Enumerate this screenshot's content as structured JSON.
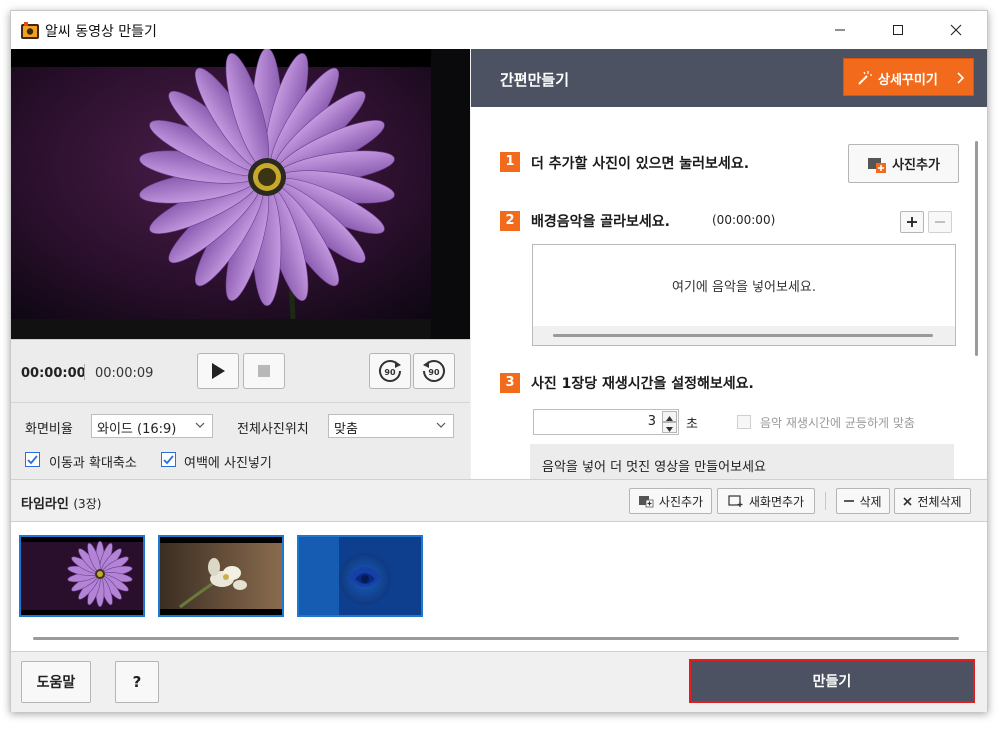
{
  "window": {
    "title": "알씨 동영상 만들기"
  },
  "player": {
    "current_time": "00:00:00",
    "total_time": "00:00:09",
    "rotate_right_label": "90",
    "rotate_left_label": "90"
  },
  "options": {
    "aspect_label": "화면비율",
    "aspect_value": "와이드 (16:9)",
    "position_label": "전체사진위치",
    "position_value": "맞춤",
    "zoom_label": "이동과 확대축소",
    "zoom_checked": true,
    "margin_label": "여백에 사진넣기",
    "margin_checked": true
  },
  "panel": {
    "title": "간편만들기",
    "decorate_button": "상세꾸미기",
    "step1_num": "1",
    "step1_text": "더 추가할 사진이 있으면 눌러보세요.",
    "add_photo_button": "사진추가",
    "step2_num": "2",
    "step2_text": "배경음악을 골라보세요.",
    "step2_time": "(00:00:00)",
    "music_placeholder": "여기에 음악을 넣어보세요.",
    "step3_num": "3",
    "step3_text": "사진 1장당 재생시간을 설정해보세요.",
    "duration_value": "3",
    "duration_unit": "초",
    "fit_music_label": "음악 재생시간에 균등하게 맞춤",
    "info_text": "음악을 넣어 더 멋진 영상을 만들어보세요"
  },
  "timeline": {
    "title": "타임라인",
    "count": "(3장)",
    "add_photo": "사진추가",
    "add_screen": "새화면추가",
    "delete": "삭제",
    "delete_all": "전체삭제"
  },
  "footer": {
    "help": "도움말",
    "question": "?",
    "make": "만들기"
  },
  "colors": {
    "accent_orange": "#f26b1d",
    "panel_dark": "#4d5263",
    "selection_blue": "#1e78d0",
    "highlight_red": "#e11d1d"
  }
}
